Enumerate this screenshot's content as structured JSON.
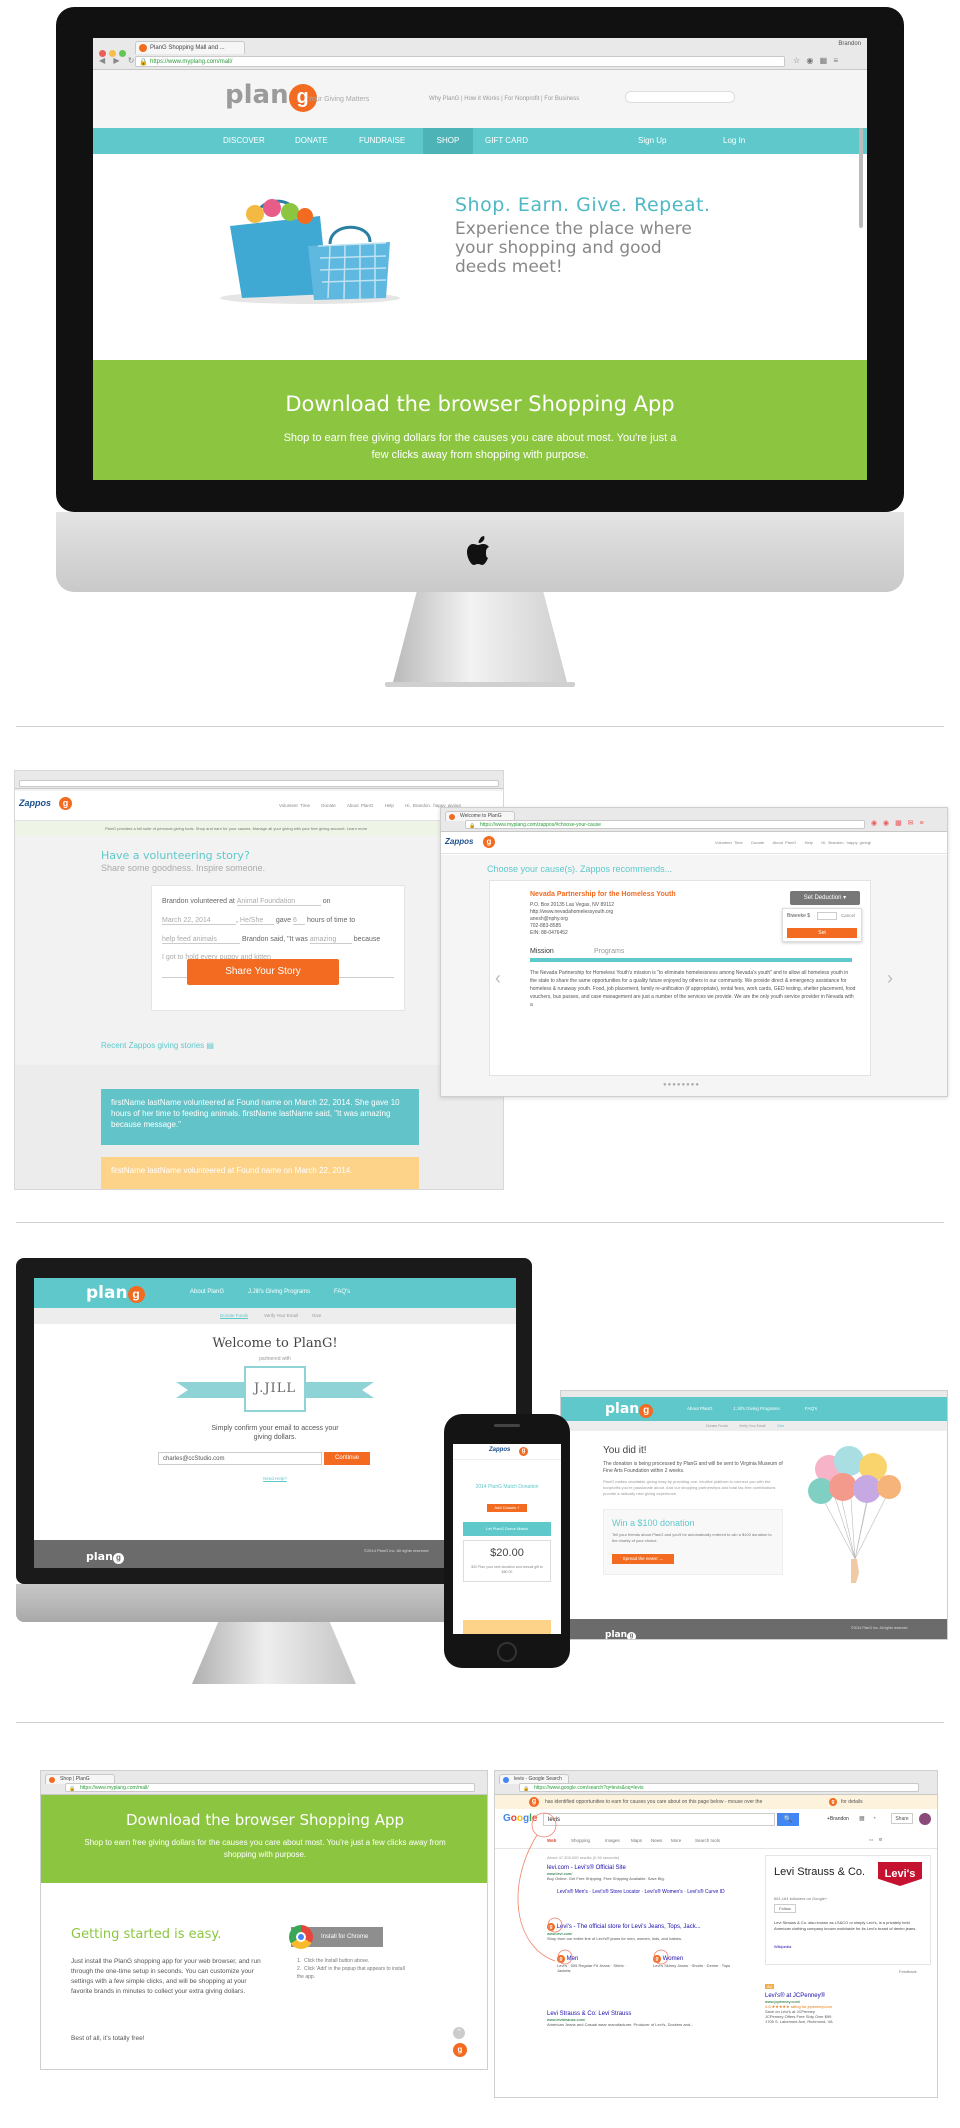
{
  "section1": {
    "tab_title": "PlanG Shopping Mall and ...",
    "user": "Brandon",
    "url": "https://www.myplang.com/mall/",
    "logo_text": "plan",
    "logo_g": "g",
    "tagline": "Your Giving Matters",
    "top_links": "Why PlanG  |  How it Works  |  For Nonprofit  |  For Business",
    "nav": [
      "DISCOVER",
      "DONATE",
      "FUNDRAISE",
      "SHOP",
      "GIFT CARD"
    ],
    "nav_right": [
      "Sign Up",
      "Log In"
    ],
    "hero_title": "Shop. Earn. Give. Repeat.",
    "hero_sub": "Experience the place where your shopping and good deeds meet!",
    "banner_title": "Download the browser Shopping App",
    "banner_sub": "Shop to earn free giving dollars for the causes you care about most. You're just a few clicks away from shopping with purpose."
  },
  "section2": {
    "zappos_logo": "Zappos",
    "top_nav": [
      "Volunteer Time",
      "Donate",
      "About PlanG",
      "Help",
      "Hi, Brandon. happy giving!"
    ],
    "notice": "PlanG provides a full suite of personal giving tools. Shop and earn for your causes. Manage all your giving with your free giving account. Learn more",
    "story_title": "Have a volunteering story?",
    "story_sub": "Share some goodness. Inspire someone.",
    "form": {
      "line1_pre": "Brandon volunteered at",
      "org": "Animal Foundation",
      "line1_post": "on",
      "date": "March 22, 2014",
      "pronoun": "He/She",
      "gave": "gave",
      "hours": "6",
      "hours_post": "hours of time to",
      "activity": "help feed animals",
      "said": "Brandon said, \"It was",
      "feeling": "amazing",
      "because": "because",
      "message": "I got to hold every puppy and kitten"
    },
    "share_button": "Share Your Story",
    "recent_title": "Recent Zappos giving stories",
    "story1": "firstName lastName volunteered at Found name on March 22, 2014. She gave 10 hours of her time to feeding animals. firstName lastName said, \"It was amazing because message.\"",
    "story2": "firstName lastName volunteered at Found name on March 22, 2014.",
    "popup": {
      "tab_title": "Welcome to PlanG",
      "url": "https://www.myplang.com/zappos/#choose-your-cause",
      "choose": "Choose your cause(s). Zappos recommends...",
      "org_name": "Nevada Partnership for the Homeless Youth",
      "org_lines": [
        "P.O. Box 20135 Las Vegas, NV 89112",
        "http://www.nevadahomelessyouth.org",
        "anesh@nphy.org",
        "702-883-8585",
        "EIN: 88-0476452"
      ],
      "deduction": "Set Deduction",
      "amount_label": "Biweeke $",
      "amount_value": "",
      "cancel": "Cancel",
      "set": "Set",
      "tabs": [
        "Mission",
        "Programs"
      ],
      "mission": "The Nevada Partnership for Homeless Youth's mission is \"to eliminate homelessness among Nevada's youth\" and to allow all homeless youth in the state to share the same opportunities for a quality future enjoyed by others in our community. We provide direct & emergency assistance for homeless & runaway youth. Food, job placement, family re-unification (if appropriate), rental fees, work cards, GED testing, shelter placement, food vouchers, bus passes, and case management are just a number of the services we provide. We are the only youth service provider in Nevada with a"
    }
  },
  "section3": {
    "nav": [
      "About PlanG",
      "J.Jill's Giving Programs",
      "FAQ's"
    ],
    "steps": [
      "Donate Funds",
      "Verify Your Email",
      "Give"
    ],
    "welcome": "Welcome to PlanG!",
    "partnered": "partnered with",
    "brand": "J.JILL",
    "confirm": "Simply confirm your email to access your giving dollars.",
    "email": "charles@ccStudio.com",
    "continue": "Continue",
    "need_help": "Need Help?",
    "footer": "©2014 PlanG Inc. All rights reserved",
    "phone": {
      "match_title": "2014 PlanG Match Donation",
      "amount_title": "Your planned donation to",
      "add_causes": "Add Causes +",
      "bar": "Let PlanG Donor Match",
      "amount": "$20.00",
      "note": "$20 Plan your next donation and annual gift to $80.00"
    },
    "done": {
      "title": "You did it!",
      "text": "The donation is being processed by PlanG and will be sent to Virginia Museum of Fine Arts Foundation within 2 weeks.",
      "text2": "PlanG makes charitable giving easy by providing one, intuitive platform to connect you with the nonprofits you're passionate about. And our shopping partnerships and total tax-free contributions provide a radically new giving experience.",
      "win": "Win a $100 donation",
      "win_text": "Tell your friends about PlanG and you'll be automatically entered to win a $100 donation to the charity of your choice.",
      "spread": "Spread the news!"
    }
  },
  "section4": {
    "left_tab": "Shop | PlanG",
    "left_url": "https://www.myplang.com/mall/",
    "banner_title": "Download the browser Shopping App",
    "banner_sub": "Shop to earn free giving dollars for the causes you care about most. You're just a few clicks away from shopping with purpose.",
    "getting_started": "Getting started is easy.",
    "gs_text": "Just install the PlanG shopping app for your web browser, and run through the one-time setup in seconds. You can customize your settings with a few simple clicks, and will be shopping at your favorite brands in minutes to collect your extra giving dollars.",
    "best": "Best of all, it's totally free!",
    "install": "Install for Chrome",
    "steps": [
      "Click the Install button above.",
      "Click 'Add' in the popup that appears to install the app."
    ],
    "right_tab": "levis - Google Search",
    "right_url": "https://www.google.com/search?q=levis&oq=levis",
    "plugin_msg": "has identified opportunities to earn for causes you care about on this page below - mouse over the",
    "plugin_msg2": "for details",
    "query": "levis",
    "user": "+Brandon",
    "share": "Share",
    "gtabs": [
      "Web",
      "Shopping",
      "Images",
      "Maps",
      "News",
      "More",
      "Search tools"
    ],
    "result_count": "About 47,300,000 results (0.36 seconds)",
    "results": [
      {
        "title": "levi.com - Levi's® Official Site",
        "url": "www.levi.com/",
        "desc": "Buy Online. Get Free Shipping. Free Shipping Available. Save Big."
      },
      {
        "title": "Levi's® Official Site - Levi.com",
        "url": "www.levi.com/",
        "desc": "Levi's® Men's · Levi's® Store Locator · Levi's® Women's · Levi's® Curve ID"
      },
      {
        "title": "Levi's - The official store for Levi's Jeans, Tops, Jack...",
        "url": "www.levi.com/",
        "desc": "Shop from our entire line of Levi's® jeans for men, women, kids, and babies."
      },
      {
        "title": "Men",
        "url": "",
        "desc": "Levi's · 505 Regular Fit Jeans · Shirts · Jackets"
      },
      {
        "title": "Women",
        "url": "",
        "desc": "Levi's Skinny Jeans · Shorts · Denim · Tops"
      },
      {
        "title": "Levi Strauss & Co: Levi Strauss",
        "url": "www.levistrauss.com/",
        "desc": "American Jeans and Casual wear manufacturer. Producer of Levi's, Dockers and..."
      }
    ],
    "kp_title": "Levi Strauss & Co.",
    "kp_followers": "661,164 followers on Google+",
    "kp_follow": "Follow",
    "kp_desc": "Levi Strauss & Co. also known as LS&CO or simply Levi's, is a privately held American clothing company known worldwide for its Levi's brand of denim jeans.",
    "kp_link": "Wikipedia",
    "feedback": "Feedback",
    "ad_title": "Levi's® at JCPenney®",
    "ad_url": "www.jcpenney.com/",
    "ad_rating": "4.6 ★★★★★ rating for jcpenney.com",
    "ad_lines": [
      "Save on Levi's at JCPenney",
      "JCPenney Offers Free Ship Over $99",
      "1705 S. Lakemont Ave, Richmond, VA"
    ]
  },
  "colors": {
    "teal": "#5fc8cb",
    "green": "#8cc640",
    "orange": "#f26b21",
    "yellow": "#fdd38a",
    "gray_footer": "#6b6b6b"
  }
}
